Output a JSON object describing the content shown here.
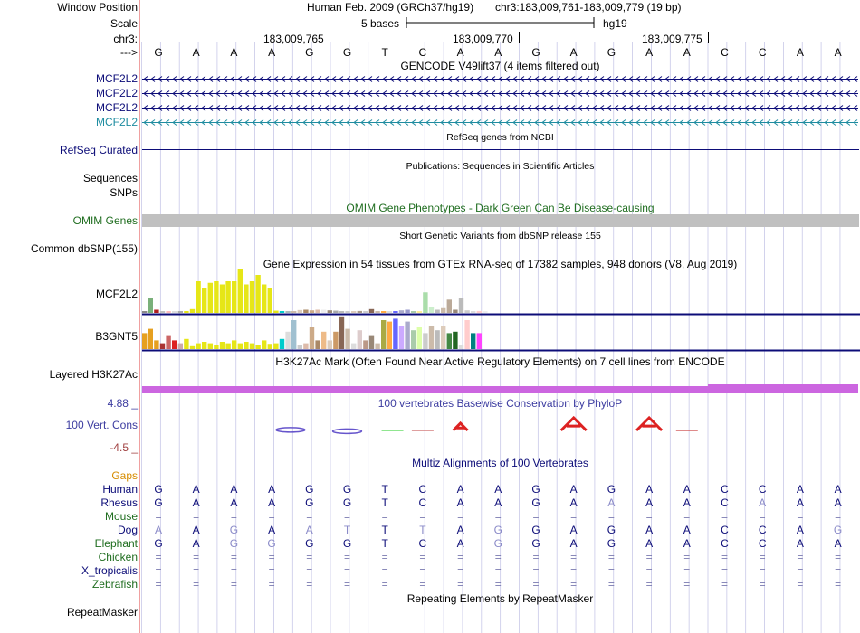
{
  "colors": {
    "grid": "#c8c8e8",
    "separator": "#f0a0a0",
    "refseq": "#0c0c78",
    "gencode_dark": "#0c0c78",
    "gencode_light": "#1e8ca0",
    "omim": "#1f6d1f",
    "omim_bar": "#c0c0c0",
    "h3k27ac": "#cc66e0",
    "cons_label": "#3c3ca0",
    "gaps_label": "#d68c00",
    "human": "#0c0c78",
    "mouse": "#1f6d1f",
    "bar_yellow": "#e6e617"
  },
  "labels": {
    "window_position": "Window Position",
    "scale": "Scale",
    "chrom": "chr3:",
    "arrow": "--->",
    "mcf2l2_1": "MCF2L2",
    "mcf2l2_2": "MCF2L2",
    "mcf2l2_3": "MCF2L2",
    "mcf2l2_4": "MCF2L2",
    "refseq": "RefSeq Curated",
    "sequences": "Sequences",
    "snps": "SNPs",
    "omim_genes": "OMIM Genes",
    "common_dbsnp": "Common dbSNP(155)",
    "gtex_mcf2l2": "MCF2L2",
    "gtex_b3gnt5": "B3GNT5",
    "layered": "Layered H3K27Ac",
    "cons_max": "4.88 _",
    "cons_name": "100 Vert. Cons",
    "cons_min": "-4.5 _",
    "gaps": "Gaps",
    "repeatmasker": "RepeatMasker"
  },
  "header": {
    "assembly": "Human Feb. 2009 (GRCh37/hg19)",
    "position": "chr3:183,009,761-183,009,779 (19 bp)",
    "scale_text": "5 bases",
    "scale_db": "hg19",
    "ticks": [
      "183,009,765",
      "183,009,770",
      "183,009,775"
    ]
  },
  "titles": {
    "gencode": "GENCODE V49lift37 (4 items filtered out)",
    "refseq": "RefSeq genes from NCBI",
    "publications": "Publications: Sequences in Scientific Articles",
    "omim": "OMIM Gene Phenotypes - Dark Green Can Be Disease-causing",
    "dbsnp": "Short Genetic Variants from dbSNP release 155",
    "gtex": "Gene Expression in 54 tissues from GTEx RNA-seq of 17382 samples, 948 donors (V8, Aug 2019)",
    "h3k27ac": "H3K27Ac Mark (Often Found Near Active Regulatory Elements) on 7 cell lines from ENCODE",
    "phylop": "100 vertebrates Basewise Conservation by PhyloP",
    "multiz": "Multiz Alignments of 100 Vertebrates",
    "repeatmasker": "Repeating Elements by RepeatMasker"
  },
  "bases": [
    "G",
    "A",
    "A",
    "A",
    "G",
    "G",
    "T",
    "C",
    "A",
    "A",
    "G",
    "A",
    "G",
    "A",
    "A",
    "C",
    "C",
    "A",
    "A"
  ],
  "alignment": [
    {
      "species": "Human",
      "color": "#0c0c78",
      "seq": [
        "G",
        "A",
        "A",
        "A",
        "G",
        "G",
        "T",
        "C",
        "A",
        "A",
        "G",
        "A",
        "G",
        "A",
        "A",
        "C",
        "C",
        "A",
        "A"
      ]
    },
    {
      "species": "Rhesus",
      "color": "#0c0c78",
      "seq": [
        "G",
        "A",
        "A",
        "A",
        "G",
        "G",
        "T",
        "C",
        "A",
        "A",
        "G",
        "A",
        "A",
        "A",
        "A",
        "C",
        "A",
        "A",
        "A"
      ]
    },
    {
      "species": "Mouse",
      "color": "#1f6d1f",
      "seq": [
        "=",
        "=",
        "=",
        "=",
        "=",
        "=",
        "=",
        "=",
        "=",
        "=",
        "=",
        "=",
        "=",
        "=",
        "=",
        "=",
        "=",
        "=",
        "="
      ]
    },
    {
      "species": "Dog",
      "color": "#0c0c78",
      "seq": [
        "A",
        "A",
        "G",
        "A",
        "A",
        "T",
        "T",
        "T",
        "A",
        "G",
        "G",
        "A",
        "G",
        "A",
        "A",
        "C",
        "C",
        "A",
        "G"
      ]
    },
    {
      "species": "Elephant",
      "color": "#1f6d1f",
      "seq": [
        "G",
        "A",
        "G",
        "G",
        "G",
        "G",
        "T",
        "C",
        "A",
        "G",
        "G",
        "A",
        "G",
        "A",
        "A",
        "C",
        "C",
        "A",
        "A"
      ]
    },
    {
      "species": "Chicken",
      "color": "#1f6d1f",
      "seq": [
        "=",
        "=",
        "=",
        "=",
        "=",
        "=",
        "=",
        "=",
        "=",
        "=",
        "=",
        "=",
        "=",
        "=",
        "=",
        "=",
        "=",
        "=",
        "="
      ]
    },
    {
      "species": "X_tropicalis",
      "color": "#0c0c78",
      "seq": [
        "=",
        "=",
        "=",
        "=",
        "=",
        "=",
        "=",
        "=",
        "=",
        "=",
        "=",
        "=",
        "=",
        "=",
        "=",
        "=",
        "=",
        "=",
        "="
      ]
    },
    {
      "species": "Zebrafish",
      "color": "#1f6d1f",
      "seq": [
        "=",
        "=",
        "=",
        "=",
        "=",
        "=",
        "=",
        "=",
        "=",
        "=",
        "=",
        "=",
        "=",
        "=",
        "=",
        "=",
        "=",
        "=",
        "="
      ]
    }
  ],
  "gtex_mcf2l2": [
    {
      "v": 0.05,
      "c": "#8a8a8a"
    },
    {
      "v": 0.48,
      "c": "#7ab07a"
    },
    {
      "v": 0.1,
      "c": "#b02020"
    },
    {
      "v": 0.05,
      "c": "#c0c0c0"
    },
    {
      "v": 0.05,
      "c": "#ffbbbb"
    },
    {
      "v": 0.05,
      "c": "#dddddd"
    },
    {
      "v": 0.05,
      "c": "#aaaaaa"
    },
    {
      "v": 0.05,
      "c": "#e6e617"
    },
    {
      "v": 0.12,
      "c": "#e6e617"
    },
    {
      "v": 1.0,
      "c": "#e6e617"
    },
    {
      "v": 0.8,
      "c": "#e6e617"
    },
    {
      "v": 0.95,
      "c": "#e6e617"
    },
    {
      "v": 1.0,
      "c": "#e6e617"
    },
    {
      "v": 0.9,
      "c": "#e6e617"
    },
    {
      "v": 1.0,
      "c": "#e6e617"
    },
    {
      "v": 1.0,
      "c": "#e6e617"
    },
    {
      "v": 1.4,
      "c": "#e6e617"
    },
    {
      "v": 0.9,
      "c": "#e6e617"
    },
    {
      "v": 1.0,
      "c": "#e6e617"
    },
    {
      "v": 1.2,
      "c": "#e6e617"
    },
    {
      "v": 0.9,
      "c": "#e6e617"
    },
    {
      "v": 0.78,
      "c": "#e6e617"
    },
    {
      "v": 0.07,
      "c": "#e6e617"
    },
    {
      "v": 0.05,
      "c": "#00cccc"
    },
    {
      "v": 0.05,
      "c": "#aabbbb"
    },
    {
      "v": 0.05,
      "c": "#ccbbaa"
    },
    {
      "v": 0.09,
      "c": "#ddccbb"
    },
    {
      "v": 0.1,
      "c": "#aa8866"
    },
    {
      "v": 0.08,
      "c": "#ccaa88"
    },
    {
      "v": 0.1,
      "c": "#ddbbaa"
    },
    {
      "v": 0.1,
      "c": "#eeeeee"
    },
    {
      "v": 0.08,
      "c": "#998877"
    },
    {
      "v": 0.07,
      "c": "#aaaaaa"
    },
    {
      "v": 0.05,
      "c": "#bbbbbb"
    },
    {
      "v": 0.05,
      "c": "#cccccc"
    },
    {
      "v": 0.05,
      "c": "#ddccbb"
    },
    {
      "v": 0.06,
      "c": "#aa9988"
    },
    {
      "v": 0.05,
      "c": "#cccccc"
    },
    {
      "v": 0.12,
      "c": "#886655"
    },
    {
      "v": 0.05,
      "c": "#ccbbaa"
    },
    {
      "v": 0.05,
      "c": "#ffaa44"
    },
    {
      "v": 0.05,
      "c": "#dddddd"
    },
    {
      "v": 0.05,
      "c": "#6666ff"
    },
    {
      "v": 0.08,
      "c": "#aaaacc"
    },
    {
      "v": 0.1,
      "c": "#9999cc"
    },
    {
      "v": 0.05,
      "c": "#aaccaa"
    },
    {
      "v": 0.05,
      "c": "#ffee99"
    },
    {
      "v": 0.65,
      "c": "#aaddaa"
    },
    {
      "v": 0.18,
      "c": "#cceecc"
    },
    {
      "v": 0.1,
      "c": "#bbbbbb"
    },
    {
      "v": 0.15,
      "c": "#ccbbaa"
    },
    {
      "v": 0.42,
      "c": "#bbaa99"
    },
    {
      "v": 0.1,
      "c": "#998877"
    },
    {
      "v": 0.48,
      "c": "#bbbbbb"
    },
    {
      "v": 0.08,
      "c": "#cccccc"
    },
    {
      "v": 0.05,
      "c": "#dddddd"
    },
    {
      "v": 0.06,
      "c": "#ffcccc"
    },
    {
      "v": 0.05,
      "c": "#eeeeee"
    }
  ],
  "gtex_b3gnt5": [
    {
      "v": 0.55,
      "c": "#e6a020"
    },
    {
      "v": 0.7,
      "c": "#e6a020"
    },
    {
      "v": 0.3,
      "c": "#e6a020"
    },
    {
      "v": 0.2,
      "c": "#aa3333"
    },
    {
      "v": 0.45,
      "c": "#cc6666"
    },
    {
      "v": 0.3,
      "c": "#dd2222"
    },
    {
      "v": 0.2,
      "c": "#ccaaaa"
    },
    {
      "v": 0.35,
      "c": "#e6e617"
    },
    {
      "v": 0.1,
      "c": "#e6e617"
    },
    {
      "v": 0.2,
      "c": "#e6e617"
    },
    {
      "v": 0.25,
      "c": "#e6e617"
    },
    {
      "v": 0.2,
      "c": "#e6e617"
    },
    {
      "v": 0.15,
      "c": "#e6e617"
    },
    {
      "v": 0.25,
      "c": "#e6e617"
    },
    {
      "v": 0.2,
      "c": "#e6e617"
    },
    {
      "v": 0.3,
      "c": "#e6e617"
    },
    {
      "v": 0.2,
      "c": "#e6e617"
    },
    {
      "v": 0.25,
      "c": "#e6e617"
    },
    {
      "v": 0.2,
      "c": "#e6e617"
    },
    {
      "v": 0.15,
      "c": "#e6e617"
    },
    {
      "v": 0.3,
      "c": "#e6e617"
    },
    {
      "v": 0.18,
      "c": "#e6e617"
    },
    {
      "v": 0.2,
      "c": "#e6e617"
    },
    {
      "v": 0.35,
      "c": "#00cccc"
    },
    {
      "v": 0.6,
      "c": "#dddddd"
    },
    {
      "v": 1.0,
      "c": "#a0c0d0"
    },
    {
      "v": 0.15,
      "c": "#cccccc"
    },
    {
      "v": 0.2,
      "c": "#ddbbaa"
    },
    {
      "v": 0.75,
      "c": "#ccaa88"
    },
    {
      "v": 0.3,
      "c": "#aa8866"
    },
    {
      "v": 0.6,
      "c": "#eebb88"
    },
    {
      "v": 0.3,
      "c": "#ddccbb"
    },
    {
      "v": 0.6,
      "c": "#cc9966"
    },
    {
      "v": 1.1,
      "c": "#886655"
    },
    {
      "v": 0.7,
      "c": "#ccbbaa"
    },
    {
      "v": 0.2,
      "c": "#dddddd"
    },
    {
      "v": 0.65,
      "c": "#ddcccc"
    },
    {
      "v": 0.3,
      "c": "#bb9988"
    },
    {
      "v": 0.45,
      "c": "#998877"
    },
    {
      "v": 0.2,
      "c": "#ccbbaa"
    },
    {
      "v": 1.0,
      "c": "#aaaa44"
    },
    {
      "v": 0.95,
      "c": "#ffaa44"
    },
    {
      "v": 1.05,
      "c": "#6666ff"
    },
    {
      "v": 0.8,
      "c": "#ccaaff"
    },
    {
      "v": 0.95,
      "c": "#aaaacc"
    },
    {
      "v": 0.65,
      "c": "#aaccaa"
    },
    {
      "v": 0.75,
      "c": "#ddffaa"
    },
    {
      "v": 0.55,
      "c": "#cccccc"
    },
    {
      "v": 0.8,
      "c": "#ccbbaa"
    },
    {
      "v": 0.65,
      "c": "#bbbbbb"
    },
    {
      "v": 0.8,
      "c": "#ddccbb"
    },
    {
      "v": 0.55,
      "c": "#448844"
    },
    {
      "v": 0.6,
      "c": "#226622"
    },
    {
      "v": 0.15,
      "c": "#dddddd"
    },
    {
      "v": 1.0,
      "c": "#ffcccc"
    },
    {
      "v": 0.55,
      "c": "#008080"
    },
    {
      "v": 0.55,
      "c": "#ff44ff"
    }
  ],
  "phylop_peaks": [
    {
      "pos": 3.5,
      "shape": "blob",
      "color": "#6655cc",
      "level": 0.1
    },
    {
      "pos": 5,
      "shape": "blob",
      "color": "#6655cc",
      "level": -0.15
    },
    {
      "pos": 6.2,
      "shape": "dash",
      "color": "#22cc22",
      "level": 0.05
    },
    {
      "pos": 7,
      "shape": "dash",
      "color": "#cc6666",
      "level": 0.02
    },
    {
      "pos": 8,
      "shape": "A",
      "color": "#dd2222",
      "level": 0.2
    },
    {
      "pos": 11,
      "shape": "A",
      "color": "#dd2222",
      "level": 0.5
    },
    {
      "pos": 13,
      "shape": "A",
      "color": "#dd2222",
      "level": 0.5
    },
    {
      "pos": 14,
      "shape": "dash",
      "color": "#cc4444",
      "level": 0.02
    }
  ]
}
